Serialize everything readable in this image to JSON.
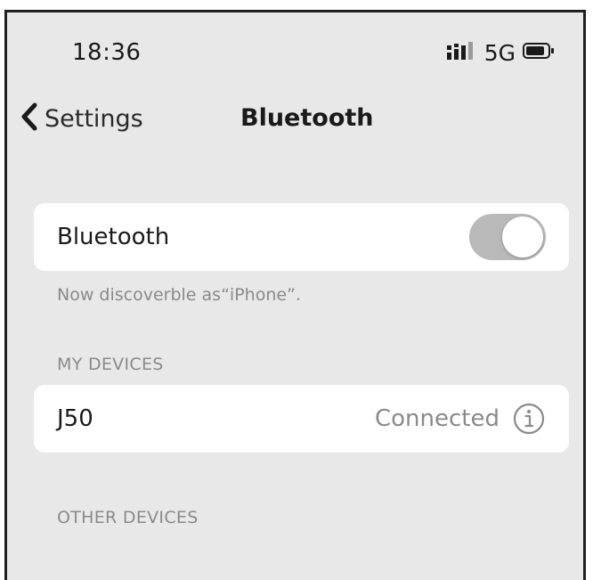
{
  "status_bar": {
    "time": "18:36",
    "network": "5G",
    "signal_icon": "signal-bars-icon",
    "battery_icon": "battery-icon"
  },
  "nav": {
    "back_label": "Settings",
    "back_icon": "chevron-left-icon",
    "title": "Bluetooth"
  },
  "bluetooth_toggle": {
    "label": "Bluetooth",
    "enabled": true
  },
  "discoverable_note": "Now discoverble as“iPhone”.",
  "my_devices": {
    "header": "MY DEVICES",
    "items": [
      {
        "name": "J50",
        "status": "Connected",
        "icon": "info-icon"
      }
    ]
  },
  "other_devices": {
    "header": "OTHER DEVICES"
  },
  "colors": {
    "background": "#e8e8e9",
    "card": "#ffffff",
    "toggle_track": "#b9b9ba",
    "secondary_text": "#8a8a8c"
  }
}
